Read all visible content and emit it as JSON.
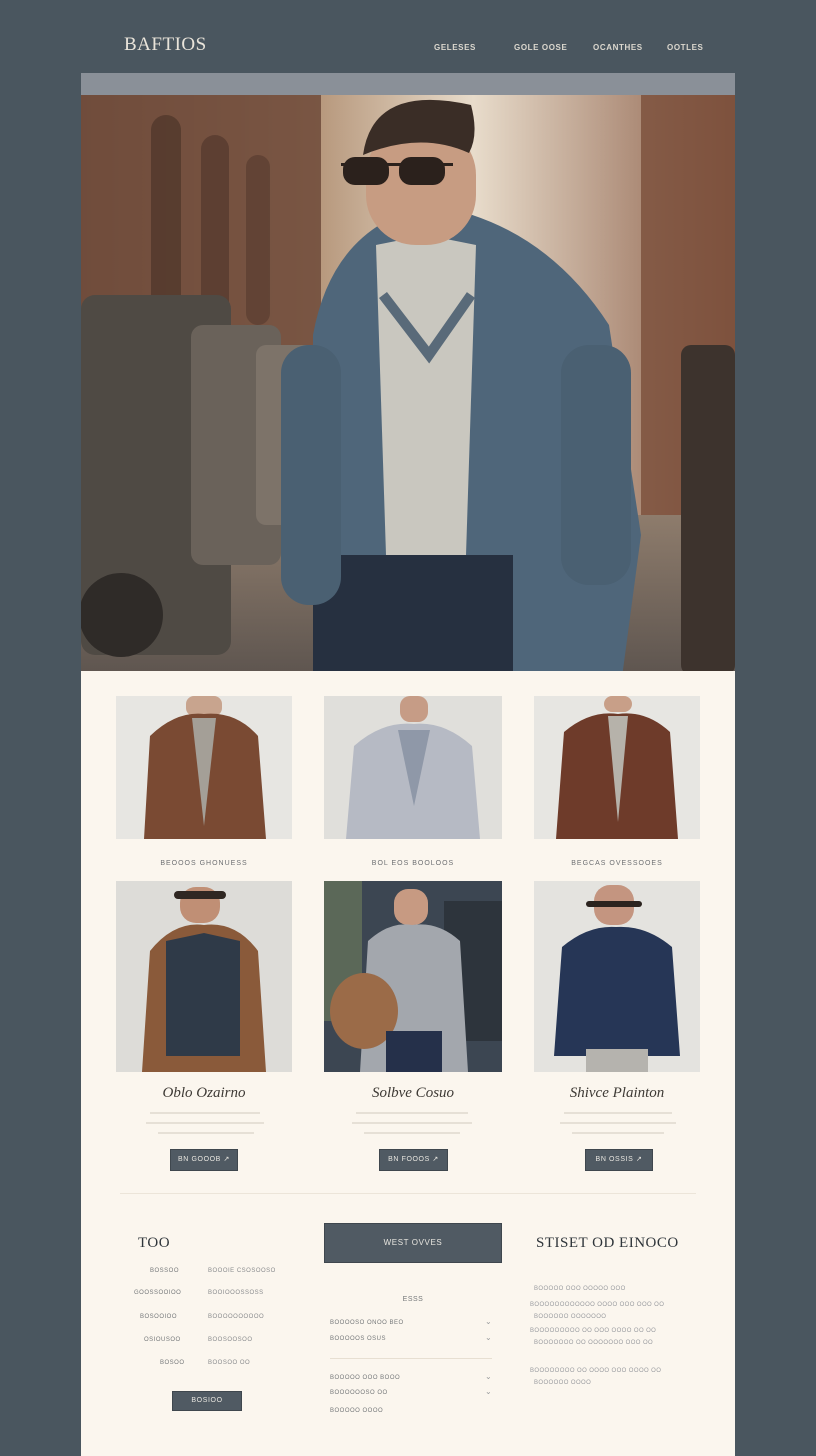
{
  "brand": {
    "logo": "BAFTIOS"
  },
  "nav": {
    "items": [
      "GELESES",
      "GOLE OOSE",
      "OCANTHES",
      "OOTLES"
    ]
  },
  "catalog": {
    "row1_captions": [
      "BEOOOS GHONUESS",
      "BOL EOS BOOLOOS",
      "BEGCAS OVESSOOES"
    ],
    "products": [
      {
        "name": "Oblo Ozairno",
        "button": "BN GOOOB"
      },
      {
        "name": "Solbve Cosuo",
        "button": "BN FOOOS"
      },
      {
        "name": "Shivce Plainton",
        "button": "BN OSSIS"
      }
    ]
  },
  "footer": {
    "left": {
      "title": "TOO",
      "rows": [
        {
          "label": "BOSSOO",
          "value": "BOOOIE CSOSOOSO"
        },
        {
          "label": "GOOSSOOIOO",
          "value": "BOOIOOOSSOSS"
        },
        {
          "label": "BOSOOIOO",
          "value": "BOOOOOOOOOO"
        },
        {
          "label": "OSIOUSOO",
          "value": "BOOSOOSOO"
        },
        {
          "label": "BOSOO",
          "value": "BOOSOO OO"
        }
      ],
      "button": "BOSIOO"
    },
    "center": {
      "button": "WEST OVVES",
      "heading": "ESSS",
      "rows": [
        "BOOOOSO ONOO BEO",
        "BOOOOOS OSUS",
        "BOOOOO OOO BOOO",
        "BOOOOOOSO OO",
        "BOOOOO OOOO"
      ]
    },
    "right": {
      "title": "STISET OD EINOCO",
      "lines": [
        "BOOOOO OOO OOOOO OOO",
        "BOOOOOOOOOOOO OOOO OOO OOO OO",
        "BOOOOOO OOOOOOO",
        "BOOOOOOOOO OO OOO OOOO OO OO",
        "BOOOOOOO OO OOOOOOO OOO OO",
        "BOOOOOOOO OO OOOO OOO OOOO OO",
        "BOOOOOO OOOO"
      ]
    }
  },
  "colors": {
    "page_bg": "#4a565f",
    "panel_bg": "#fbf6ee",
    "button_bg": "#505a63",
    "topbar": "#8a9098"
  }
}
